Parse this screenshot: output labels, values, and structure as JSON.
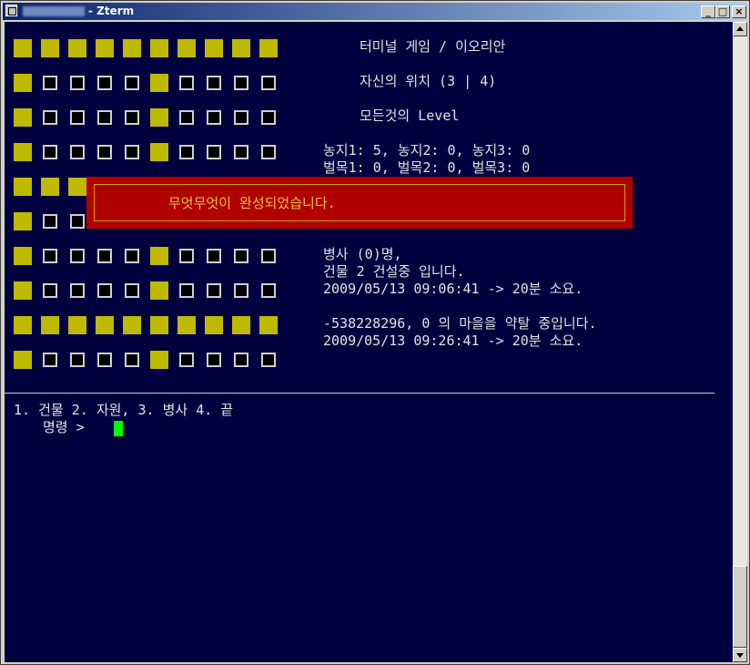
{
  "window": {
    "title": "- Zterm",
    "colors": {
      "terminal_bg": "#00003e",
      "cell_filled": "#bfb900",
      "popup_bg": "#b10000",
      "popup_text": "#e6c24a",
      "cursor": "#00ff00"
    }
  },
  "grid": [
    "FFFFFFFFFF",
    "FEEEEFEEEE",
    "FEEEEFEEEE",
    "FEEEEFEEEE",
    "FFF",
    "FEE",
    "FEEEEFEEEE",
    "FEEEEFEEEE",
    "FFFFFFFFFF",
    "FEEEEFEEEE"
  ],
  "info": {
    "title": "터미널 게임 / 이오리안",
    "position": "자신의 위치 (3 | 4)",
    "level": "모든것의 Level",
    "farm": "농지1: 5, 농지2: 0, 농지3: 0",
    "lumber": "벌목1: 0, 벌목2: 0, 벌목3: 0",
    "soldiers": "병사 (0)명,",
    "building": "건물 2 건설중 입니다.",
    "building_time": "2009/05/13 09:06:41 -> 20분 소요.",
    "attack": "-538228296, 0 의 마을을 약탈 중입니다.",
    "attack_time": "2009/05/13 09:26:41 -> 20분 소요."
  },
  "popup": {
    "message": "무엇무엇이 완성되었습니다."
  },
  "menu": {
    "options": "1. 건물 2. 자원, 3. 병사 4. 끝",
    "prompt": "명령 >"
  }
}
